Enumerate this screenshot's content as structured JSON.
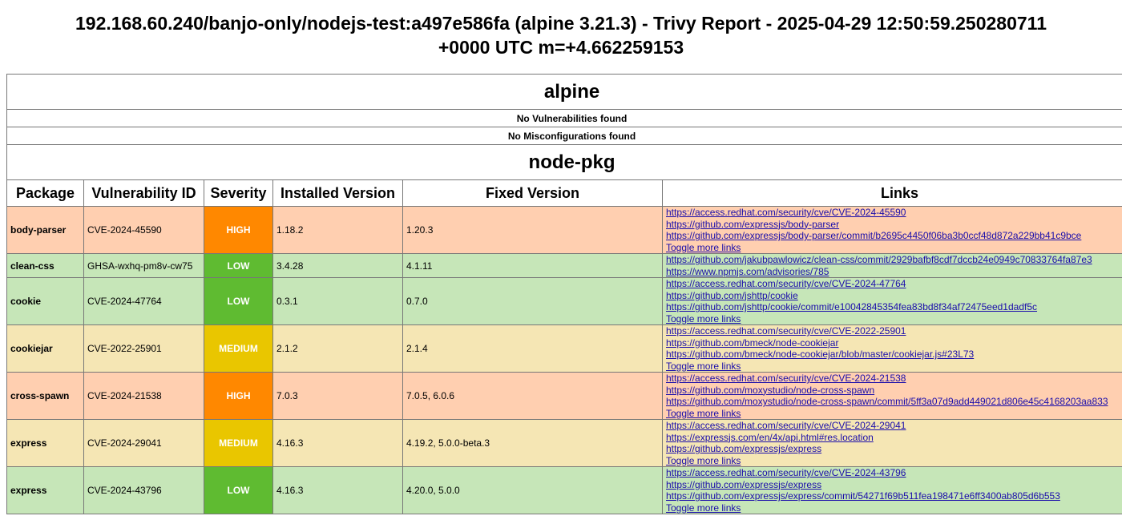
{
  "title_line1": "192.168.60.240/banjo-only/nodejs-test:a497e586fa (alpine 3.21.3) - Trivy Report - 2025-04-29 12:50:59.250280711",
  "title_line2": "+0000 UTC m=+4.662259153",
  "alpine": {
    "name": "alpine",
    "no_vulns": "No Vulnerabilities found",
    "no_misconfigs": "No Misconfigurations found"
  },
  "node_pkg": {
    "name": "node-pkg",
    "headers": [
      "Package",
      "Vulnerability ID",
      "Severity",
      "Installed Version",
      "Fixed Version",
      "Links"
    ],
    "toggle_label": "Toggle more links",
    "rows": [
      {
        "package": "body-parser",
        "id": "CVE-2024-45590",
        "severity": "HIGH",
        "installed": "1.18.2",
        "fixed": "1.20.3",
        "links": [
          "https://access.redhat.com/security/cve/CVE-2024-45590",
          "https://github.com/expressjs/body-parser",
          "https://github.com/expressjs/body-parser/commit/b2695c4450f06ba3b0ccf48d872a229bb41c9bce"
        ],
        "toggle": true
      },
      {
        "package": "clean-css",
        "id": "GHSA-wxhq-pm8v-cw75",
        "severity": "LOW",
        "installed": "3.4.28",
        "fixed": "4.1.11",
        "links": [
          "https://github.com/jakubpawlowicz/clean-css/commit/2929bafbf8cdf7dccb24e0949c70833764fa87e3",
          "https://www.npmjs.com/advisories/785"
        ],
        "toggle": false
      },
      {
        "package": "cookie",
        "id": "CVE-2024-47764",
        "severity": "LOW",
        "installed": "0.3.1",
        "fixed": "0.7.0",
        "links": [
          "https://access.redhat.com/security/cve/CVE-2024-47764",
          "https://github.com/jshttp/cookie",
          "https://github.com/jshttp/cookie/commit/e10042845354fea83bd8f34af72475eed1dadf5c"
        ],
        "toggle": true
      },
      {
        "package": "cookiejar",
        "id": "CVE-2022-25901",
        "severity": "MEDIUM",
        "installed": "2.1.2",
        "fixed": "2.1.4",
        "links": [
          "https://access.redhat.com/security/cve/CVE-2022-25901",
          "https://github.com/bmeck/node-cookiejar",
          "https://github.com/bmeck/node-cookiejar/blob/master/cookiejar.js#23L73"
        ],
        "toggle": true
      },
      {
        "package": "cross-spawn",
        "id": "CVE-2024-21538",
        "severity": "HIGH",
        "installed": "7.0.3",
        "fixed": "7.0.5, 6.0.6",
        "links": [
          "https://access.redhat.com/security/cve/CVE-2024-21538",
          "https://github.com/moxystudio/node-cross-spawn",
          "https://github.com/moxystudio/node-cross-spawn/commit/5ff3a07d9add449021d806e45c4168203aa833"
        ],
        "toggle": true
      },
      {
        "package": "express",
        "id": "CVE-2024-29041",
        "severity": "MEDIUM",
        "installed": "4.16.3",
        "fixed": "4.19.2, 5.0.0-beta.3",
        "links": [
          "https://access.redhat.com/security/cve/CVE-2024-29041",
          "https://expressjs.com/en/4x/api.html#res.location",
          "https://github.com/expressjs/express"
        ],
        "toggle": true
      },
      {
        "package": "express",
        "id": "CVE-2024-43796",
        "severity": "LOW",
        "installed": "4.16.3",
        "fixed": "4.20.0, 5.0.0",
        "links": [
          "https://access.redhat.com/security/cve/CVE-2024-43796",
          "https://github.com/expressjs/express",
          "https://github.com/expressjs/express/commit/54271f69b511fea198471e6ff3400ab805d6b553"
        ],
        "toggle": true
      }
    ]
  },
  "colors": {
    "high_badge": "#ff8800",
    "medium_badge": "#e9c600",
    "low_badge": "#5fbb31",
    "high_row": "#ffcfb0",
    "medium_row": "#f5e6b4",
    "low_row": "#c6e6b8",
    "link": "#1a0dab"
  }
}
